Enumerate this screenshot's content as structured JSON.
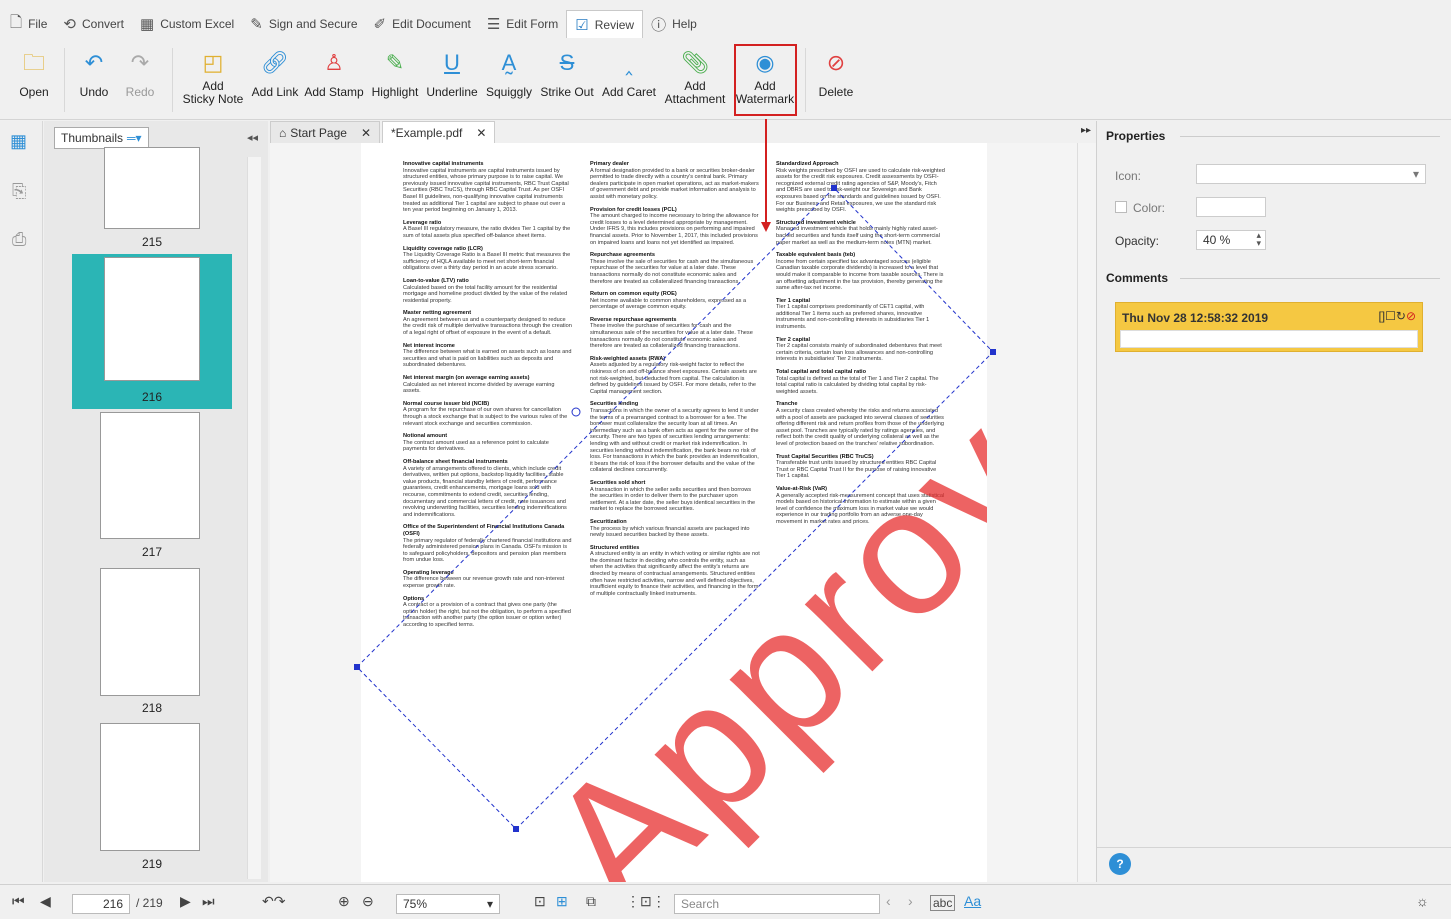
{
  "menu": [
    "File",
    "Convert",
    "Custom Excel",
    "Sign and Secure",
    "Edit Document",
    "Edit Form",
    "Review",
    "Help"
  ],
  "ribbon": {
    "open": "Open",
    "undo": "Undo",
    "redo": "Redo",
    "sticky1": "Add",
    "sticky2": "Sticky Note",
    "link": "Add Link",
    "stamp": "Add Stamp",
    "highlight": "Highlight",
    "underline": "Underline",
    "squiggly": "Squiggly",
    "strike": "Strike Out",
    "caret": "Add Caret",
    "att1": "Add",
    "att2": "Attachment",
    "wm1": "Add",
    "wm2": "Watermark",
    "delete": "Delete"
  },
  "thumbs": {
    "dropdown": "Thumbnails",
    "pages": [
      "215",
      "216",
      "217",
      "218",
      "219"
    ]
  },
  "tabs": [
    "Start Page",
    "*Example.pdf"
  ],
  "document": {
    "watermark": "Approved",
    "col1": [
      {
        "h": "Innovative capital instruments",
        "t": "Innovative capital instruments are capital instruments issued by structured entities, whose primary purpose is to raise capital. We previously issued innovative capital instruments, RBC Trust Capital Securities (RBC TruCS), through RBC Capital Trust. As per OSFI Basel III guidelines, non-qualifying innovative capital instruments treated as additional Tier 1 capital are subject to phase out over a ten year period beginning on January 1, 2013."
      },
      {
        "h": "Leverage ratio",
        "t": "A Basel III regulatory measure, the ratio divides Tier 1 capital by the sum of total assets plus specified off-balance sheet items."
      },
      {
        "h": "Liquidity coverage ratio (LCR)",
        "t": "The Liquidity Coverage Ratio is a Basel III metric that measures the sufficiency of HQLA available to meet net short-term financial obligations over a thirty day period in an acute stress scenario."
      },
      {
        "h": "Loan-to-value (LTV) ratio",
        "t": "Calculated based on the total facility amount for the residential mortgage and homeline product divided by the value of the related residential property."
      },
      {
        "h": "Master netting agreement",
        "t": "An agreement between us and a counterparty designed to reduce the credit risk of multiple derivative transactions through the creation of a legal right of offset of exposure in the event of a default."
      },
      {
        "h": "Net interest income",
        "t": "The difference between what is earned on assets such as loans and securities and what is paid on liabilities such as deposits and subordinated debentures."
      },
      {
        "h": "Net interest margin (on average earning assets)",
        "t": "Calculated as net interest income divided by average earning assets."
      },
      {
        "h": "Normal course issuer bid (NCIB)",
        "t": "A program for the repurchase of our own shares for cancellation through a stock exchange that is subject to the various rules of the relevant stock exchange and securities commission."
      },
      {
        "h": "Notional amount",
        "t": "The contract amount used as a reference point to calculate payments for derivatives."
      },
      {
        "h": "Off-balance sheet financial instruments",
        "t": "A variety of arrangements offered to clients, which include credit derivatives, written put options, backstop liquidity facilities, stable value products, financial standby letters of credit, performance guarantees, credit enhancements, mortgage loans sold with recourse, commitments to extend credit, securities lending, documentary and commercial letters of credit, note issuances and revolving underwriting facilities, securities lending indemnifications and indemnifications."
      },
      {
        "h": "Office of the Superintendent of Financial Institutions Canada (OSFI)",
        "t": "The primary regulator of federally chartered financial institutions and federally administered pension plans in Canada. OSFI's mission is to safeguard policyholders, depositors and pension plan members from undue loss."
      },
      {
        "h": "Operating leverage",
        "t": "The difference between our revenue growth rate and non-interest expense growth rate."
      },
      {
        "h": "Options",
        "t": "A contract or a provision of a contract that gives one party (the option holder) the right, but not the obligation, to perform a specified transaction with another party (the option issuer or option writer) according to specified terms."
      }
    ],
    "col2": [
      {
        "h": "Primary dealer",
        "t": "A formal designation provided to a bank or securities broker-dealer permitted to trade directly with a country's central bank. Primary dealers participate in open market operations, act as market-makers of government debt and provide market information and analysis to assist with monetary policy."
      },
      {
        "h": "Provision for credit losses (PCL)",
        "t": "The amount charged to income necessary to bring the allowance for credit losses to a level determined appropriate by management. Under IFRS 9, this includes provisions on performing and impaired financial assets. Prior to November 1, 2017, this included provisions on impaired loans and loans not yet identified as impaired."
      },
      {
        "h": "Repurchase agreements",
        "t": "These involve the sale of securities for cash and the simultaneous repurchase of the securities for value at a later date. These transactions normally do not constitute economic sales and therefore are treated as collateralized financing transactions."
      },
      {
        "h": "Return on common equity (ROE)",
        "t": "Net income available to common shareholders, expressed as a percentage of average common equity."
      },
      {
        "h": "Reverse repurchase agreements",
        "t": "These involve the purchase of securities for cash and the simultaneous sale of the securities for value at a later date. These transactions normally do not constitute economic sales and therefore are treated as collateralized financing transactions."
      },
      {
        "h": "Risk-weighted assets (RWA)",
        "t": "Assets adjusted by a regulatory risk-weight factor to reflect the riskiness of on and off-balance sheet exposures. Certain assets are not risk-weighted, but deducted from capital. The calculation is defined by guidelines issued by OSFI. For more details, refer to the Capital management section."
      },
      {
        "h": "Securities lending",
        "t": "Transactions in which the owner of a security agrees to lend it under the terms of a prearranged contract to a borrower for a fee. The borrower must collateralize the security loan at all times. An intermediary such as a bank often acts as agent for the owner of the security. There are two types of securities lending arrangements: lending with and without credit or market risk indemnification. In securities lending without indemnification, the bank bears no risk of loss. For transactions in which the bank provides an indemnification, it bears the risk of loss if the borrower defaults and the value of the collateral declines concurrently."
      },
      {
        "h": "Securities sold short",
        "t": "A transaction in which the seller sells securities and then borrows the securities in order to deliver them to the purchaser upon settlement. At a later date, the seller buys identical securities in the market to replace the borrowed securities."
      },
      {
        "h": "Securitization",
        "t": "The process by which various financial assets are packaged into newly issued securities backed by these assets."
      },
      {
        "h": "Structured entities",
        "t": "A structured entity is an entity in which voting or similar rights are not the dominant factor in deciding who controls the entity, such as when the activities that significantly affect the entity's returns are directed by means of contractual arrangements. Structured entities often have restricted activities, narrow and well defined objectives, insufficient equity to finance their activities, and financing in the form of multiple contractually linked instruments."
      }
    ],
    "col3": [
      {
        "h": "Standardized Approach",
        "t": "Risk weights prescribed by OSFI are used to calculate risk-weighted assets for the credit risk exposures. Credit assessments by OSFI-recognized external credit rating agencies of S&P, Moody's, Fitch and DBRS are used to risk-weight our Sovereign and Bank exposures based on the standards and guidelines issued by OSFI. For our Business and Retail exposures, we use the standard risk weights prescribed by OSFI."
      },
      {
        "h": "Structured investment vehicle",
        "t": "Managed investment vehicle that holds mainly highly rated asset-backed securities and funds itself using the short-term commercial paper market as well as the medium-term notes (MTN) market."
      },
      {
        "h": "Taxable equivalent basis (teb)",
        "t": "Income from certain specified tax advantaged sources (eligible Canadian taxable corporate dividends) is increased to a level that would make it comparable to income from taxable sources. There is an offsetting adjustment in the tax provision, thereby generating the same after-tax net income."
      },
      {
        "h": "Tier 1 capital",
        "t": "Tier 1 capital comprises predominantly of CET1 capital, with additional Tier 1 items such as preferred shares, innovative instruments and non-controlling interests in subsidiaries Tier 1 instruments."
      },
      {
        "h": "Tier 2 capital",
        "t": "Tier 2 capital consists mainly of subordinated debentures that meet certain criteria, certain loan loss allowances and non-controlling interests in subsidiaries' Tier 2 instruments."
      },
      {
        "h": "Total capital and total capital ratio",
        "t": "Total capital is defined as the total of Tier 1 and Tier 2 capital. The total capital ratio is calculated by dividing total capital by risk-weighted assets."
      },
      {
        "h": "Tranche",
        "t": "A security class created whereby the risks and returns associated with a pool of assets are packaged into several classes of securities offering different risk and return profiles from those of the underlying asset pool. Tranches are typically rated by ratings agencies, and reflect both the credit quality of underlying collateral as well as the level of protection based on the tranches' relative subordination."
      },
      {
        "h": "Trust Capital Securities (RBC TruCS)",
        "t": "Transferable trust units issued by structured entities RBC Capital Trust or RBC Capital Trust II for the purpose of raising innovative Tier 1 capital."
      },
      {
        "h": "Value-at-Risk (VaR)",
        "t": "A generally accepted risk-measurement concept that uses statistical models based on historical information to estimate within a given level of confidence the maximum loss in market value we would experience in our trading portfolio from an adverse one-day movement in market rates and prices."
      }
    ]
  },
  "properties": {
    "title": "Properties",
    "icon_label": "Icon:",
    "color_label": "Color:",
    "opacity_label": "Opacity:",
    "opacity_value": "40 %",
    "comments_title": "Comments",
    "comment_date": "Thu Nov 28 12:58:32 2019"
  },
  "status": {
    "page": "216",
    "total": "/ 219",
    "zoom": "75%",
    "search_placeholder": "Search",
    "abc": "abc",
    "aa": "Aa"
  }
}
